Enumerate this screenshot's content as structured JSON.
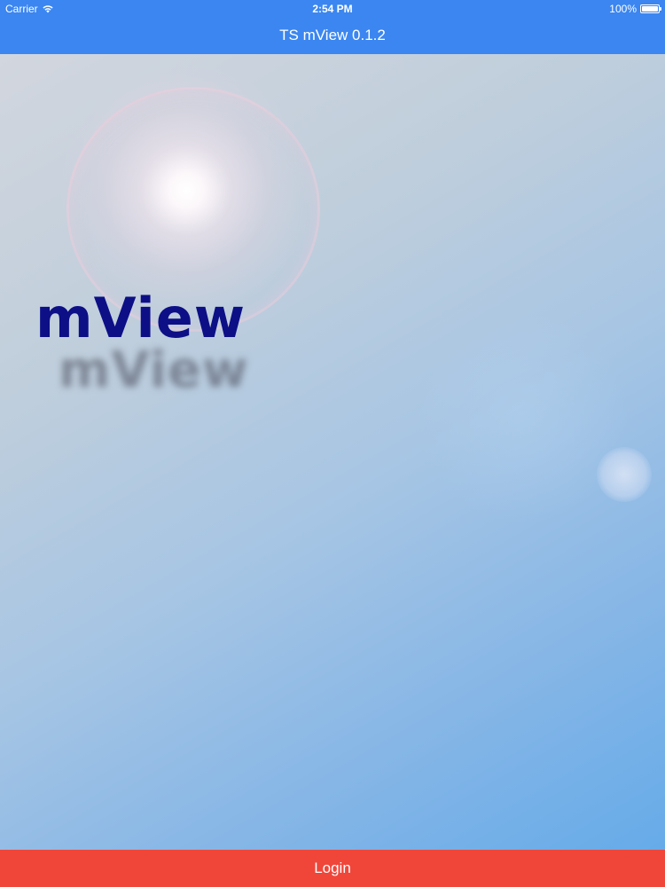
{
  "status_bar": {
    "carrier": "Carrier",
    "time": "2:54 PM",
    "battery": "100%",
    "wifi_icon": "wifi-icon",
    "battery_icon": "battery-icon"
  },
  "nav": {
    "title": "TS mView 0.1.2"
  },
  "hero": {
    "logo_text": "mView",
    "logo_reflection": "mView",
    "colors": {
      "logo": "#0c0f86",
      "header": "#3b86f0"
    }
  },
  "footer": {
    "login_label": "Login",
    "color": "#f0463a"
  }
}
